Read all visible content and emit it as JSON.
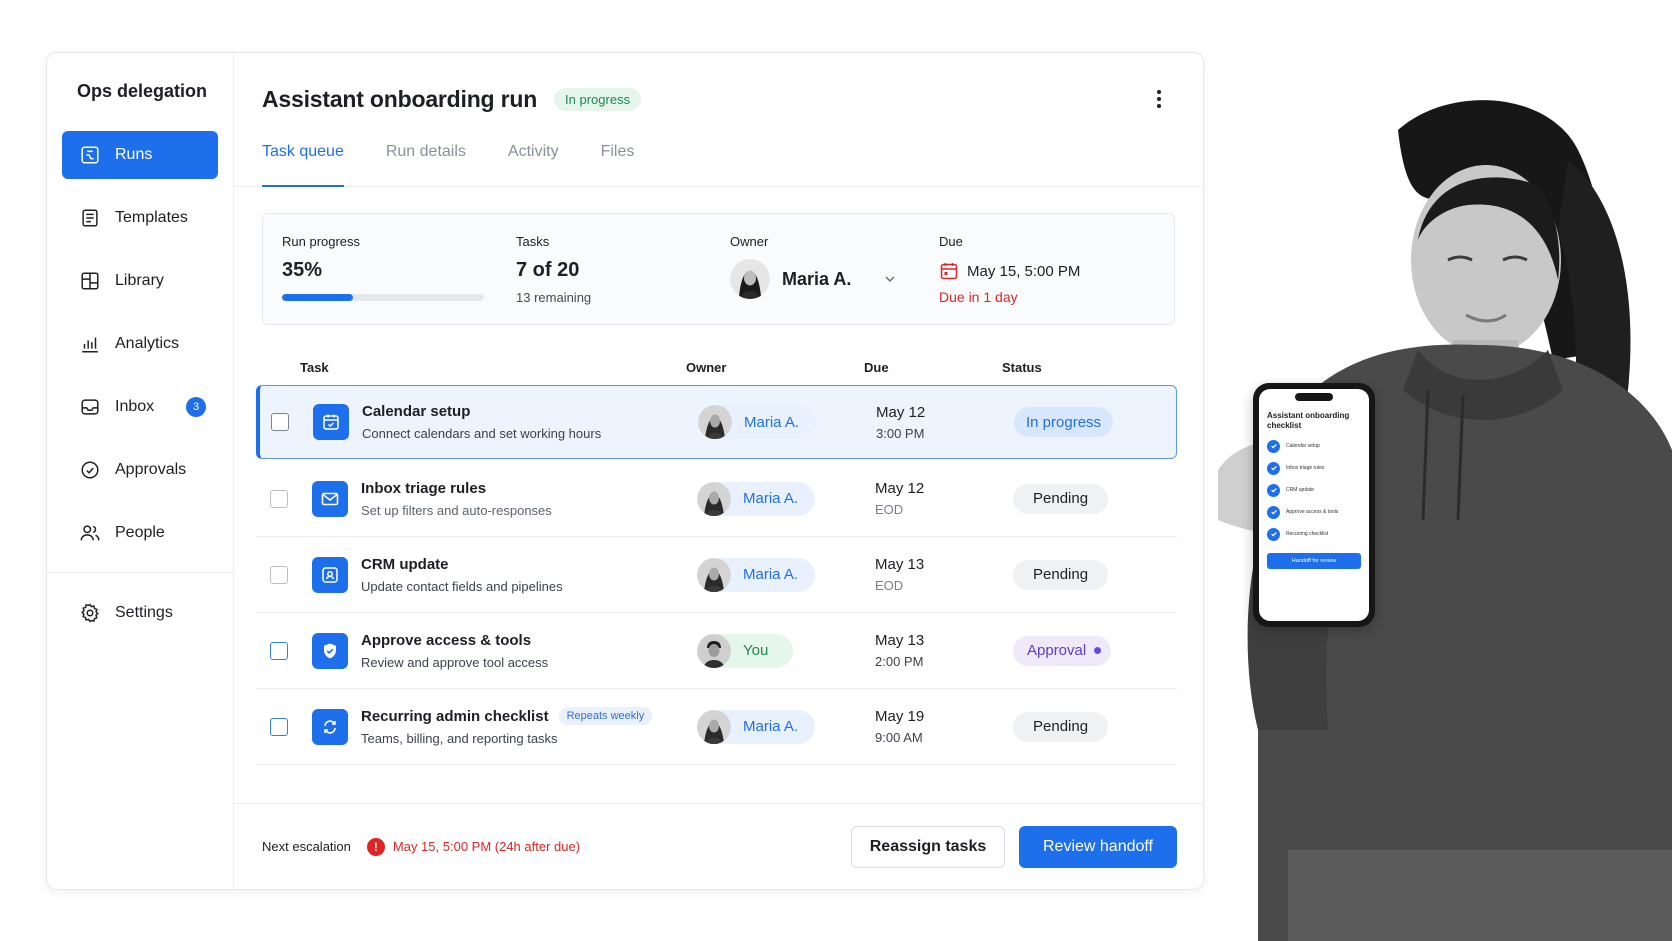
{
  "app": {
    "brand": "Ops delegation"
  },
  "sidebar": {
    "items": [
      {
        "label": "Runs",
        "icon": "runs-icon",
        "active": true
      },
      {
        "label": "Templates",
        "icon": "templates-icon"
      },
      {
        "label": "Library",
        "icon": "library-icon"
      },
      {
        "label": "Analytics",
        "icon": "analytics-icon"
      },
      {
        "label": "Inbox",
        "icon": "inbox-icon",
        "badge": "3"
      },
      {
        "label": "Approvals",
        "icon": "approvals-icon"
      },
      {
        "label": "People",
        "icon": "people-icon"
      }
    ],
    "settings": {
      "label": "Settings",
      "icon": "gear-icon"
    }
  },
  "header": {
    "title": "Assistant onboarding run",
    "status": "In progress"
  },
  "tabs": [
    {
      "label": "Task queue",
      "active": true
    },
    {
      "label": "Run details"
    },
    {
      "label": "Activity"
    },
    {
      "label": "Files"
    }
  ],
  "summary": {
    "progress_label": "Run progress",
    "progress_value": "35%",
    "progress_fraction": 0.35,
    "tasks_label": "Tasks",
    "tasks_value": "7 of 20",
    "tasks_remaining": "13 remaining",
    "owner_label": "Owner",
    "owner_name": "Maria A.",
    "due_label": "Due",
    "due_value": "May 15, 5:00 PM",
    "due_warning": "Due in 1 day"
  },
  "table": {
    "columns": {
      "task": "Task",
      "owner": "Owner",
      "due": "Due",
      "status": "Status"
    },
    "rows": [
      {
        "title": "Calendar setup",
        "subtitle": "Connect calendars and set working hours",
        "owner": "Maria A.",
        "due_date": "May 12",
        "due_time": "3:00 PM",
        "status": "In progress"
      },
      {
        "title": "Inbox triage rules",
        "subtitle": "Set up filters and auto-responses",
        "owner": "Maria A.",
        "due_date": "May 12",
        "due_time": "EOD",
        "status": "Pending"
      },
      {
        "title": "CRM update",
        "subtitle": "Update contact fields and pipelines",
        "owner": "Maria A.",
        "due_date": "May 13",
        "due_time": "EOD",
        "status": "Pending"
      },
      {
        "title": "Approve access & tools",
        "subtitle": "Review and approve tool access",
        "owner": "You",
        "due_date": "May 13",
        "due_time": "2:00 PM",
        "status": "Approval"
      },
      {
        "title": "Recurring admin checklist",
        "pill": "Repeats weekly",
        "subtitle": "Teams, billing, and reporting tasks",
        "owner": "Maria A.",
        "due_date": "May 19",
        "due_time": "9:00 AM",
        "status": "Pending"
      }
    ]
  },
  "footer": {
    "escalation_label": "Next escalation",
    "escalation_value": "May 15, 5:00 PM (24h after due)",
    "reassign_label": "Reassign tasks",
    "review_label": "Review handoff"
  },
  "phone": {
    "title": "Assistant onboarding checklist",
    "items": [
      "Calendar setup",
      "Inbox triage rules",
      "CRM update",
      "Approve access & tools",
      "Recurring checklist"
    ],
    "button": "Handoff for review"
  },
  "colors": {
    "accent": "#1e6fec",
    "success": "#1c8a4a",
    "danger": "#e02424",
    "approval": "#5b3fc8"
  }
}
